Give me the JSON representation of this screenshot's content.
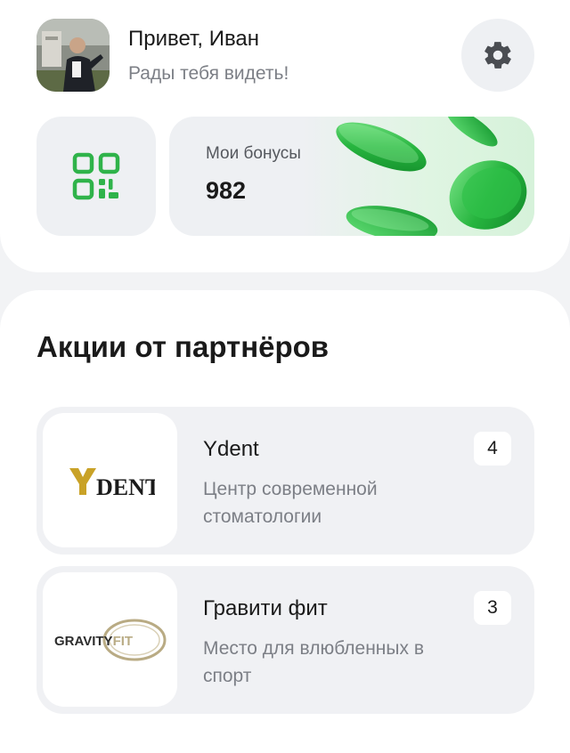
{
  "header": {
    "greeting": "Привет, Иван",
    "subgreeting": "Рады тебя видеть!",
    "avatar_icon": "user-photo",
    "settings_icon": "gear-icon"
  },
  "qr": {
    "icon": "qr-code-icon",
    "accent": "#2fb34a"
  },
  "bonus": {
    "label": "Мои бонусы",
    "value": "982",
    "decoration": "green-coins"
  },
  "partners": {
    "title": "Акции от партнёров",
    "items": [
      {
        "name": "Ydent",
        "description": "Центр современной стоматологии",
        "count": "4",
        "logo_text": "YDENT"
      },
      {
        "name": "Гравити фит",
        "description": "Место для влюбленных в спорт",
        "count": "3",
        "logo_text": "GRAVITYFIT"
      }
    ]
  },
  "colors": {
    "accent_green": "#2fb34a",
    "card_bg": "#eef0f3",
    "text_muted": "#7c7f86",
    "ydent_gold": "#c9a227"
  }
}
